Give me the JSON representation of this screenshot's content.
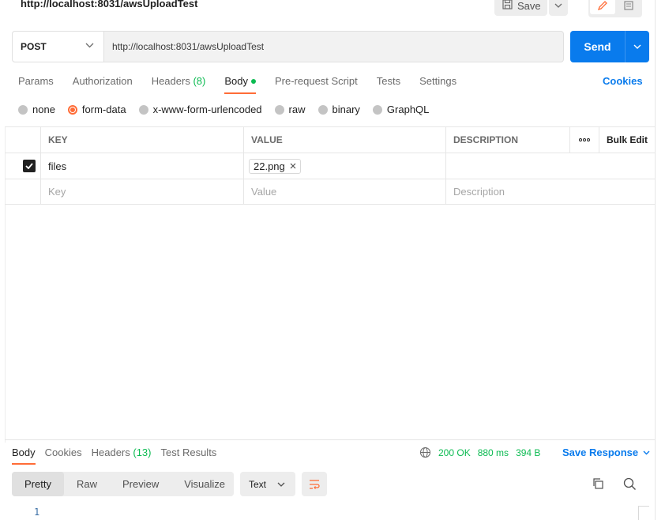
{
  "header": {
    "title": "http://localhost:8031/awsUploadTest",
    "save_label": "Save"
  },
  "request": {
    "method": "POST",
    "url": "http://localhost:8031/awsUploadTest",
    "send_label": "Send"
  },
  "tabs": [
    {
      "label": "Params"
    },
    {
      "label": "Authorization"
    },
    {
      "label": "Headers",
      "count": "(8)"
    },
    {
      "label": "Body"
    },
    {
      "label": "Pre-request Script"
    },
    {
      "label": "Tests"
    },
    {
      "label": "Settings"
    }
  ],
  "cookies_label": "Cookies",
  "body_types": [
    "none",
    "form-data",
    "x-www-form-urlencoded",
    "raw",
    "binary",
    "GraphQL"
  ],
  "body_type_selected": "form-data",
  "table": {
    "headers": {
      "key": "KEY",
      "value": "VALUE",
      "description": "DESCRIPTION",
      "bulk_edit": "Bulk Edit"
    },
    "rows": [
      {
        "checked": true,
        "key": "files",
        "value_file": "22.png",
        "description": ""
      }
    ],
    "placeholders": {
      "key": "Key",
      "value": "Value",
      "description": "Description"
    }
  },
  "response": {
    "tabs": [
      {
        "label": "Body"
      },
      {
        "label": "Cookies"
      },
      {
        "label": "Headers",
        "count": "(13)"
      },
      {
        "label": "Test Results"
      }
    ],
    "status": "200 OK",
    "time": "880 ms",
    "size": "394 B",
    "save_response_label": "Save Response",
    "formats": [
      "Pretty",
      "Raw",
      "Preview",
      "Visualize"
    ],
    "format_selected": "Pretty",
    "text_type": "Text",
    "line_number": "1"
  },
  "colors": {
    "accent_orange": "#ff6c37",
    "primary_blue": "#097bed",
    "success_green": "#0cbb52"
  }
}
